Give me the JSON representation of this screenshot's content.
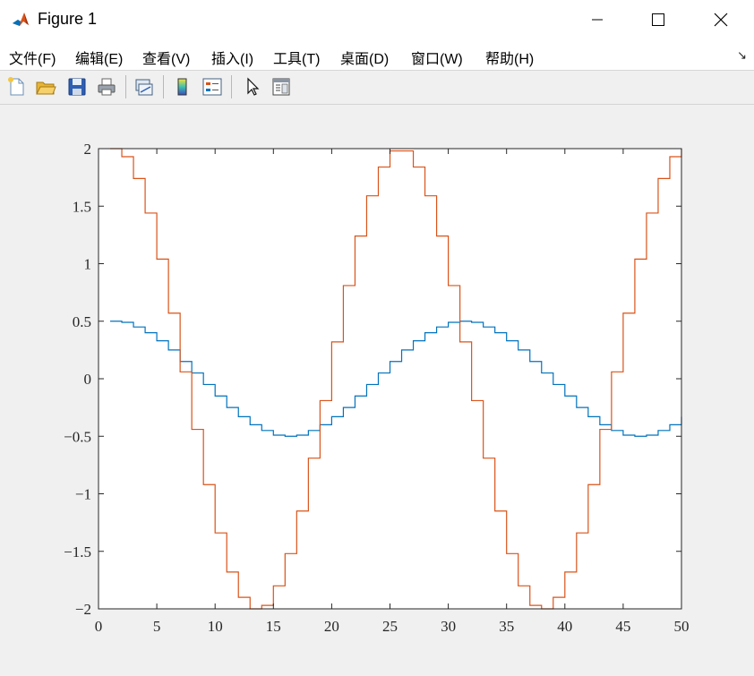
{
  "window": {
    "title": "Figure 1",
    "controls": {
      "minimize_icon": "minimize-icon",
      "maximize_icon": "maximize-icon",
      "close_icon": "close-icon"
    }
  },
  "menu": {
    "items": [
      "文件(F)",
      "编辑(E)",
      "查看(V)",
      "插入(I)",
      "工具(T)",
      "桌面(D)",
      "窗口(W)",
      "帮助(H)"
    ],
    "corner_glyph": "↘"
  },
  "toolbar": {
    "buttons": [
      "new-figure-icon",
      "open-file-icon",
      "save-icon",
      "print-icon",
      "link-plot-icon",
      "colorbar-icon",
      "legend-icon",
      "edit-plot-arrow-icon",
      "property-inspector-icon"
    ]
  },
  "colors": {
    "series1": "#0072BD",
    "series2": "#D95319",
    "axes": "#262626",
    "window_bg": "#f0f0f0"
  },
  "chart_data": {
    "type": "line",
    "style": "stairs",
    "title": "",
    "xlabel": "",
    "ylabel": "",
    "xlim": [
      0,
      50
    ],
    "ylim": [
      -2,
      2
    ],
    "xticks": [
      0,
      5,
      10,
      15,
      20,
      25,
      30,
      35,
      40,
      45,
      50
    ],
    "yticks": [
      -2,
      -1.5,
      -1,
      -0.5,
      0,
      0.5,
      1,
      1.5,
      2
    ],
    "xtick_labels": [
      "0",
      "5",
      "10",
      "15",
      "20",
      "25",
      "30",
      "35",
      "40",
      "45",
      "50"
    ],
    "ytick_labels": [
      "−2",
      "−1.5",
      "−1",
      "−0.5",
      "0",
      "0.5",
      "1",
      "1.5",
      "2"
    ],
    "grid": false,
    "legend": "none",
    "x": [
      1,
      2,
      3,
      4,
      5,
      6,
      7,
      8,
      9,
      10,
      11,
      12,
      13,
      14,
      15,
      16,
      17,
      18,
      19,
      20,
      21,
      22,
      23,
      24,
      25,
      26,
      27,
      28,
      29,
      30,
      31,
      32,
      33,
      34,
      35,
      36,
      37,
      38,
      39,
      40,
      41,
      42,
      43,
      44,
      45,
      46,
      47,
      48,
      49,
      50
    ],
    "series": [
      {
        "values": [
          0.5,
          0.49,
          0.45,
          0.4,
          0.33,
          0.25,
          0.15,
          0.05,
          -0.05,
          -0.15,
          -0.25,
          -0.33,
          -0.4,
          -0.45,
          -0.49,
          -0.5,
          -0.49,
          -0.45,
          -0.4,
          -0.33,
          -0.25,
          -0.15,
          -0.05,
          0.05,
          0.15,
          0.25,
          0.33,
          0.4,
          0.45,
          0.49,
          0.5,
          0.49,
          0.45,
          0.4,
          0.33,
          0.25,
          0.15,
          0.05,
          -0.05,
          -0.15,
          -0.25,
          -0.33,
          -0.4,
          -0.45,
          -0.49,
          -0.5,
          -0.49,
          -0.45,
          -0.4,
          -0.33
        ]
      },
      {
        "values": [
          2.0,
          1.93,
          1.74,
          1.44,
          1.04,
          0.57,
          0.06,
          -0.44,
          -0.92,
          -1.34,
          -1.68,
          -1.9,
          -2.0,
          -1.97,
          -1.8,
          -1.52,
          -1.15,
          -0.69,
          -0.19,
          0.32,
          0.81,
          1.24,
          1.59,
          1.84,
          1.98,
          1.98,
          1.84,
          1.59,
          1.24,
          0.81,
          0.32,
          -0.19,
          -0.69,
          -1.15,
          -1.52,
          -1.8,
          -1.97,
          -2.0,
          -1.9,
          -1.68,
          -1.34,
          -0.92,
          -0.44,
          0.06,
          0.57,
          1.04,
          1.44,
          1.74,
          1.93,
          2.0
        ]
      }
    ]
  }
}
